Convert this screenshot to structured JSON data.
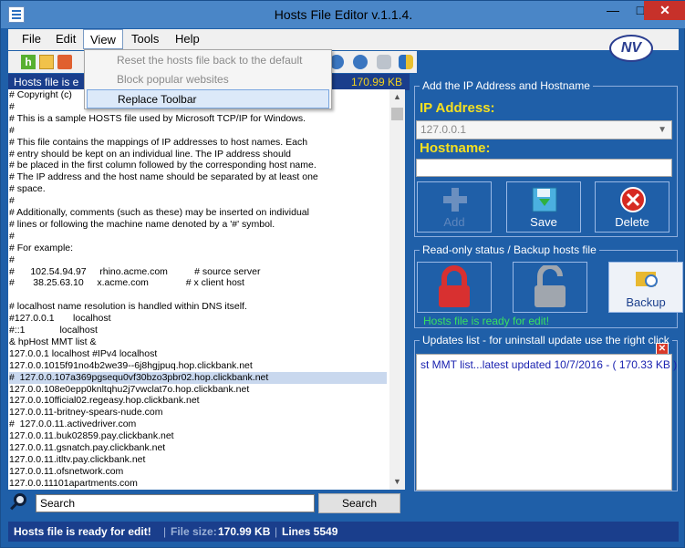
{
  "window": {
    "title": "Hosts File Editor v.1.1.4.",
    "min": "—",
    "max": "□",
    "close": "✕"
  },
  "menu": {
    "file": "File",
    "edit": "Edit",
    "view": "View",
    "tools": "Tools",
    "help": "Help"
  },
  "logo_text": "NV",
  "view_menu": {
    "items": [
      {
        "label": "Reset the hosts file back to the default",
        "enabled": false
      },
      {
        "label": "Block popular websites",
        "enabled": false
      },
      {
        "label": "Replace Toolbar",
        "enabled": true
      }
    ]
  },
  "editor": {
    "header_left": "Hosts file is e",
    "header_right": "170.99 KB",
    "lines": [
      "# Copyright (c)",
      "#",
      "# This is a sample HOSTS file used by Microsoft TCP/IP for Windows.",
      "#",
      "# This file contains the mappings of IP addresses to host names. Each",
      "# entry should be kept on an individual line. The IP address should",
      "# be placed in the first column followed by the corresponding host name.",
      "# The IP address and the host name should be separated by at least one",
      "# space.",
      "#",
      "# Additionally, comments (such as these) may be inserted on individual",
      "# lines or following the machine name denoted by a '#' symbol.",
      "#",
      "# For example:",
      "#",
      "#      102.54.94.97     rhino.acme.com          # source server",
      "#       38.25.63.10     x.acme.com              # x client host",
      "",
      "# localhost name resolution is handled within DNS itself.",
      "#127.0.0.1       localhost",
      "#::1             localhost",
      "& hpHost MMT list &",
      "127.0.0.1 localhost #IPv4 localhost",
      "127.0.0.1015f91no4b2we39--6j8hgjpuq.hop.clickbank.net",
      "#  127.0.0.107a369pgsequ0vf30bzo3pbr02.hop.clickbank.net",
      "127.0.0.108e0epp0knltqhu2j7vwclat7o.hop.clickbank.net",
      "127.0.0.10fficial02.regeasy.hop.clickbank.net",
      "127.0.0.11-britney-spears-nude.com",
      "#  127.0.0.11.activedriver.com",
      "127.0.0.11.buk02859.pay.clickbank.net",
      "127.0.0.11.gsnatch.pay.clickbank.net",
      "127.0.0.11.itltv.pay.clickbank.net",
      "127.0.0.11.ofsnetwork.com",
      "127.0.0.11101apartments.com"
    ],
    "selected_line_index": 24
  },
  "search": {
    "value": "Search",
    "button": "Search"
  },
  "add_group": {
    "title": "Add the IP Address  and Hostname",
    "ip_label": "IP Address:",
    "ip_value": "127.0.0.1",
    "hostname_label": "Hostname:",
    "hostname_value": "",
    "buttons": {
      "add": "Add",
      "save": "Save",
      "delete": "Delete"
    }
  },
  "readonly_group": {
    "title": "Read-only status / Backup hosts file",
    "backup": "Backup",
    "status": "Hosts file is ready for edit!"
  },
  "updates_group": {
    "title": "Updates list -  for uninstall update use the right click",
    "entries": [
      "st MMT list...latest updated 10/7/2016 - ( 170.33 KB )"
    ]
  },
  "statusbar": {
    "status": "Hosts file is ready for edit!",
    "sep1": "|",
    "filesize_label": "File size:",
    "filesize_value": "170.99 KB",
    "sep2": "|",
    "lines": "Lines 5549"
  },
  "colors": {
    "window_bg": "#1f5fa8",
    "header_bg": "#1a3e8c",
    "accent_yellow": "#f5e020",
    "ready_green": "#38e060",
    "link_blue": "#1a22b0"
  },
  "icons": {
    "lock_closed": "lock-closed-icon",
    "lock_open": "lock-open-icon",
    "backup": "folder-clock-icon",
    "search": "magnifier-icon",
    "add": "plus-icon",
    "save": "floppy-icon",
    "delete": "delete-circle-icon"
  }
}
